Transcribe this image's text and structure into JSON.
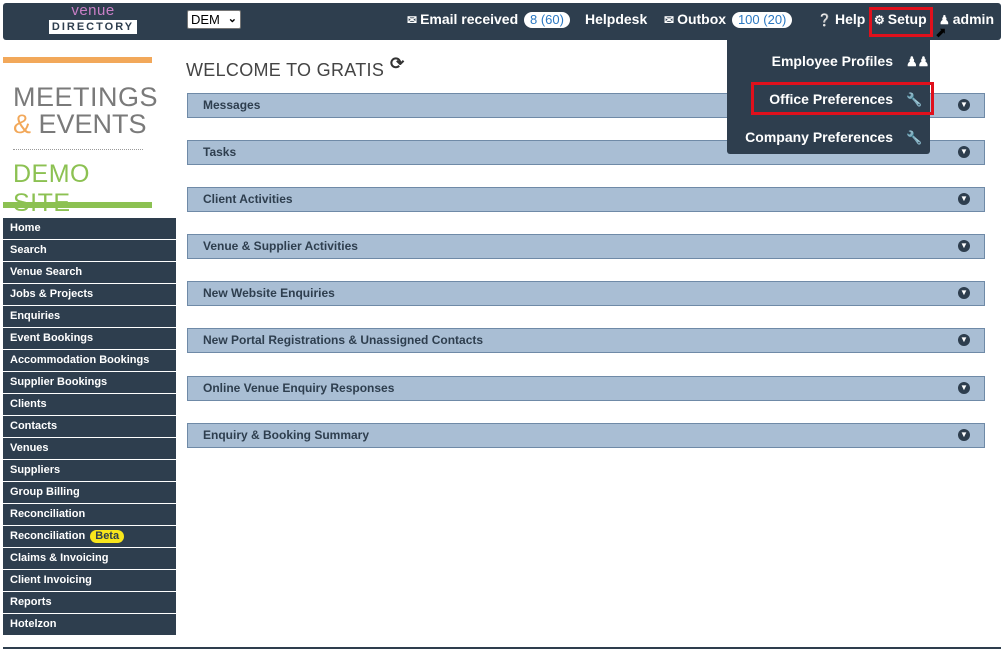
{
  "header": {
    "logo_top": "venue",
    "logo_bottom": "DIRECTORY",
    "office_select": "DEM",
    "email_label": "Email received",
    "email_count": "8 (60)",
    "helpdesk": "Helpdesk",
    "outbox_label": "Outbox",
    "outbox_count": "100 (20)",
    "help": "Help",
    "setup": "Setup",
    "user": "admin"
  },
  "setup_menu": {
    "items": [
      {
        "label": "Employee Profiles",
        "icon": "users-icon"
      },
      {
        "label": "Office Preferences",
        "icon": "wrench-icon"
      },
      {
        "label": "Company Preferences",
        "icon": "wrench-icon"
      }
    ]
  },
  "brand": {
    "line1": "MEETINGS",
    "amp": "&",
    "line2": "EVENTS",
    "line3": "DEMO SITE"
  },
  "sidebar": {
    "items": [
      {
        "label": "Home"
      },
      {
        "label": "Search"
      },
      {
        "label": "Venue Search"
      },
      {
        "label": "Jobs & Projects"
      },
      {
        "label": "Enquiries"
      },
      {
        "label": "Event Bookings"
      },
      {
        "label": "Accommodation Bookings"
      },
      {
        "label": "Supplier Bookings"
      },
      {
        "label": "Clients"
      },
      {
        "label": "Contacts"
      },
      {
        "label": "Venues"
      },
      {
        "label": "Suppliers"
      },
      {
        "label": "Group Billing"
      },
      {
        "label": "Reconciliation"
      },
      {
        "label": "Reconciliation",
        "badge": "Beta"
      },
      {
        "label": "Claims & Invoicing"
      },
      {
        "label": "Client Invoicing"
      },
      {
        "label": "Reports"
      },
      {
        "label": "Hotelzon"
      }
    ]
  },
  "main": {
    "title": "WELCOME TO GRATIS",
    "panels": [
      {
        "label": "Messages"
      },
      {
        "label": "Tasks"
      },
      {
        "label": "Client Activities"
      },
      {
        "label": "Venue & Supplier Activities"
      },
      {
        "label": "New Website Enquiries"
      },
      {
        "label": "New Portal Registrations & Unassigned Contacts"
      },
      {
        "label": "Online Venue Enquiry Responses"
      },
      {
        "label": "Enquiry & Booking Summary"
      }
    ]
  },
  "colors": {
    "nav_bg": "#2e3e4e",
    "panel_bg": "#a9bed4",
    "highlight": "#e0101c",
    "beta": "#f8e61c"
  }
}
